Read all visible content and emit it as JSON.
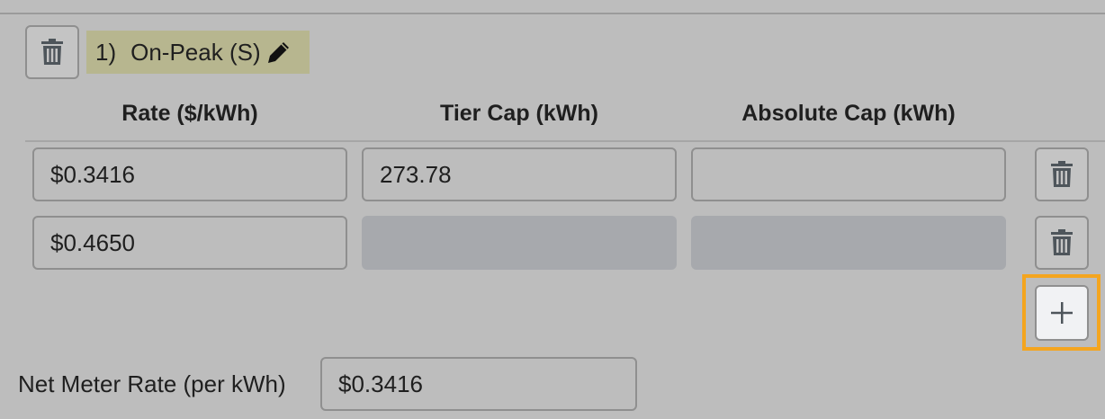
{
  "tier": {
    "number": "1)",
    "name": "On-Peak (S)"
  },
  "columns": {
    "rate": "Rate ($/kWh)",
    "tier_cap": "Tier Cap (kWh)",
    "absolute_cap": "Absolute Cap (kWh)"
  },
  "rows": [
    {
      "rate": "$0.3416",
      "tier_cap": "273.78",
      "absolute_cap": ""
    },
    {
      "rate": "$0.4650",
      "tier_cap": "",
      "absolute_cap": ""
    }
  ],
  "net_meter": {
    "label": "Net Meter Rate (per kWh)",
    "value": "$0.3416"
  },
  "icons": {
    "delete": "trash-icon",
    "edit": "pencil-icon",
    "add": "plus-icon"
  },
  "colors": {
    "title_highlight": "#b7b68f",
    "focus_ring": "#f4a51f",
    "disabled_field": "#a7a9ad"
  }
}
